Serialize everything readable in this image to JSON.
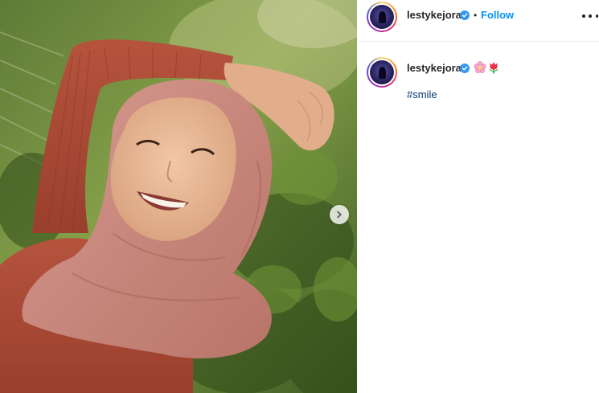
{
  "post": {
    "username": "lestykejora",
    "verified": true,
    "follow_label": "Follow",
    "separator": "•",
    "caption": {
      "author": "lestykejora",
      "emojis": [
        "cherry-blossom-emoji",
        "tulip-emoji"
      ],
      "hashtag": "#smile"
    }
  },
  "icons": {
    "next": "chevron-right-icon",
    "more": "more-options-icon",
    "verified": "verified-badge-icon"
  },
  "colors": {
    "follow": "#0095f6",
    "verified": "#3897f0",
    "hashtag": "#00376b"
  }
}
